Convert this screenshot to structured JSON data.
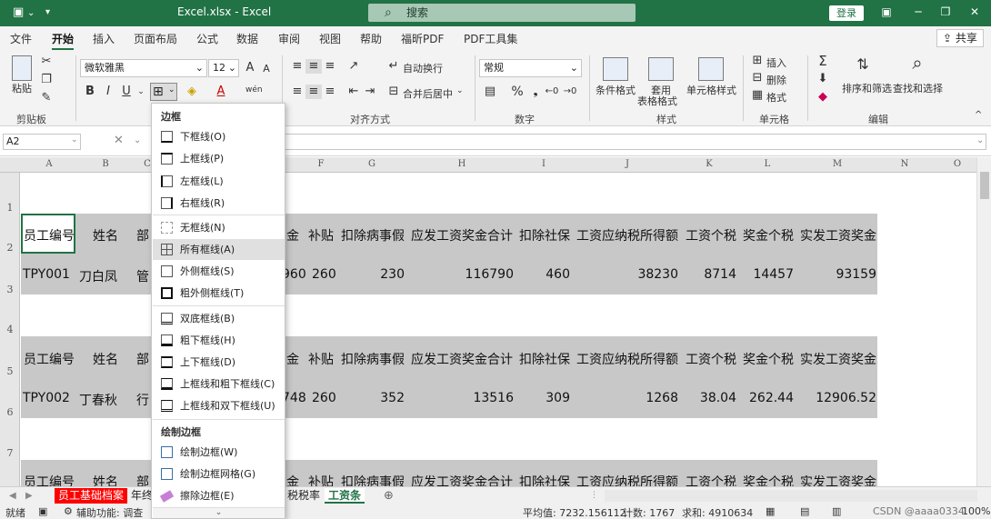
{
  "titlebar": {
    "filename": "Excel.xlsx",
    "sep": "-",
    "app": "Excel",
    "search_placeholder": "搜索",
    "login": "登录"
  },
  "tabs": [
    "文件",
    "开始",
    "插入",
    "页面布局",
    "公式",
    "数据",
    "审阅",
    "视图",
    "帮助",
    "福昕PDF",
    "PDF工具集"
  ],
  "active_tab": "开始",
  "share": "共享",
  "ribbon": {
    "paste": "粘贴",
    "clipboard": "剪贴板",
    "font_name": "微软雅黑",
    "font_size": "12",
    "bold": "B",
    "italic": "I",
    "underline": "U",
    "grow": "A",
    "shrink": "A",
    "wrap": "自动换行",
    "merge": "合并后居中",
    "alignment": "对齐方式",
    "number_format": "常规",
    "number": "数字",
    "percent": "%",
    "cond_format": "条件格式",
    "table_format_1": "套用",
    "table_format_2": "表格格式",
    "cell_style": "单元格样式",
    "styles": "样式",
    "insert": "插入",
    "delete": "删除",
    "format": "格式",
    "cells": "单元格",
    "sort_filter": "排序和筛选",
    "find_select": "查找和选择",
    "editing": "编辑",
    "sigma": "Σ",
    "phonetic": "wén"
  },
  "formula_bar": {
    "name_box": "A2",
    "fx": "fx"
  },
  "columns": [
    "A",
    "B",
    "C",
    "F",
    "G",
    "H",
    "I",
    "J",
    "K",
    "L",
    "M",
    "N",
    "O"
  ],
  "rows": [
    "1",
    "2",
    "3",
    "4",
    "5",
    "6",
    "7"
  ],
  "headers": {
    "c1": "员工编号",
    "c2": "姓名",
    "c3": "部",
    "e": "金",
    "f": "补贴",
    "g": "扣除病事假",
    "h": "应发工资奖金合计",
    "i": "扣除社保",
    "j": "工资应纳税所得额",
    "k": "工资个税",
    "l": "奖金个税",
    "m": "实发工资奖金"
  },
  "records": [
    {
      "id": "TPY001",
      "name": "刀白凤",
      "dept": "管",
      "e": "960",
      "f": "260",
      "g": "230",
      "h": "116790",
      "i": "460",
      "j": "38230",
      "k": "8714",
      "l": "14457",
      "m": "93159"
    },
    {
      "id": "TPY002",
      "name": "丁春秋",
      "dept": "行",
      "e": "748",
      "f": "260",
      "g": "352",
      "h": "13516",
      "i": "309",
      "j": "1268",
      "k": "38.04",
      "l": "262.44",
      "m": "12906.52"
    }
  ],
  "menu": {
    "title": "边框",
    "items": [
      "下框线(O)",
      "上框线(P)",
      "左框线(L)",
      "右框线(R)",
      "无框线(N)",
      "所有框线(A)",
      "外侧框线(S)",
      "粗外侧框线(T)",
      "双底框线(B)",
      "粗下框线(H)",
      "上下框线(D)",
      "上框线和粗下框线(C)",
      "上框线和双下框线(U)"
    ],
    "highlighted": "所有框线(A)",
    "draw_title": "绘制边框",
    "draw_items": [
      "绘制边框(W)",
      "绘制边框网格(G)",
      "擦除边框(E)"
    ]
  },
  "sheets": {
    "sheet1": "员工基础档案",
    "sheet2": "年终",
    "sheet3": "税税率",
    "sheet4": "工资条"
  },
  "status": {
    "ready": "就绪",
    "accessibility": "辅助功能: 调查",
    "average": "平均值: 7232.156112",
    "count": "计数: 1767",
    "sum": "求和: 4910634",
    "zoom": "100%",
    "watermark": "CSDN @aaaa0334"
  },
  "colors": {
    "excel_green": "#217346",
    "band_gray": "#c8c8c8",
    "red_tab": "#ff0000"
  }
}
